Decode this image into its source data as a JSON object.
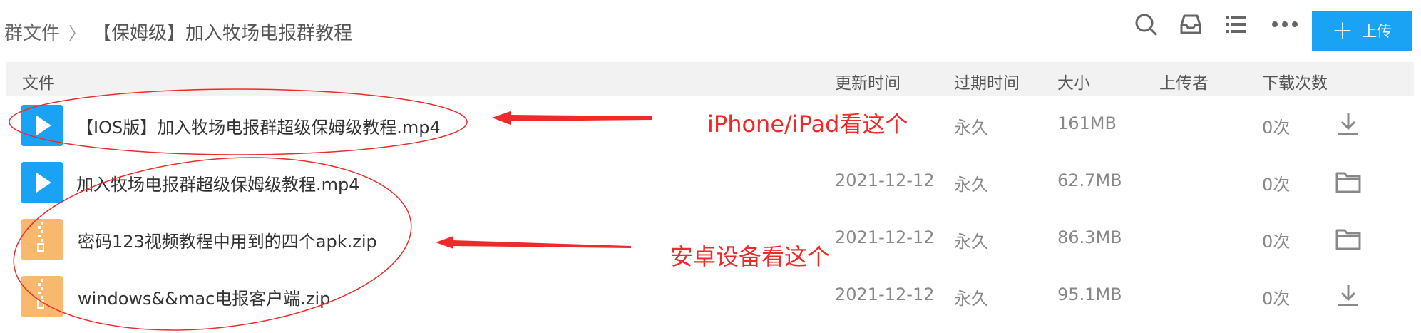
{
  "breadcrumb": {
    "root": "群文件",
    "separator": "〉",
    "current": "【保姆级】加入牧场电报群教程"
  },
  "toolbar": {
    "upload_label": "上传",
    "icons": [
      "search-icon",
      "inbox-icon",
      "list-view-icon",
      "more-icon"
    ]
  },
  "table": {
    "columns": {
      "file": "文件",
      "updated": "更新时间",
      "expires": "过期时间",
      "size": "大小",
      "uploader": "上传者",
      "downloads": "下载次数"
    },
    "rows": [
      {
        "type": "video",
        "name": "【IOS版】加入牧场电报群超级保姆级教程.mp4",
        "updated": "",
        "expires": "永久",
        "size": "161MB",
        "uploader": "",
        "downloads": "0次",
        "action_icon": "download-icon"
      },
      {
        "type": "video",
        "name": "加入牧场电报群超级保姆级教程.mp4",
        "updated": "2021-12-12",
        "expires": "永久",
        "size": "62.7MB",
        "uploader": "",
        "downloads": "0次",
        "action_icon": "folder-icon"
      },
      {
        "type": "zip",
        "name": "密码123视频教程中用到的四个apk.zip",
        "updated": "2021-12-12",
        "expires": "永久",
        "size": "86.3MB",
        "uploader": "",
        "downloads": "0次",
        "action_icon": "folder-icon"
      },
      {
        "type": "zip",
        "name": "windows&&mac电报客户端.zip",
        "updated": "2021-12-12",
        "expires": "永久",
        "size": "95.1MB",
        "uploader": "",
        "downloads": "0次",
        "action_icon": "download-icon"
      }
    ]
  },
  "annotations": {
    "ios_note": "iPhone/iPad看这个",
    "android_note": "安卓设备看这个",
    "color": "#ee2a2a"
  },
  "colors": {
    "accent": "#1aa3f5",
    "zip_icon": "#f8b86d",
    "header_bg": "#f2f2f2"
  }
}
